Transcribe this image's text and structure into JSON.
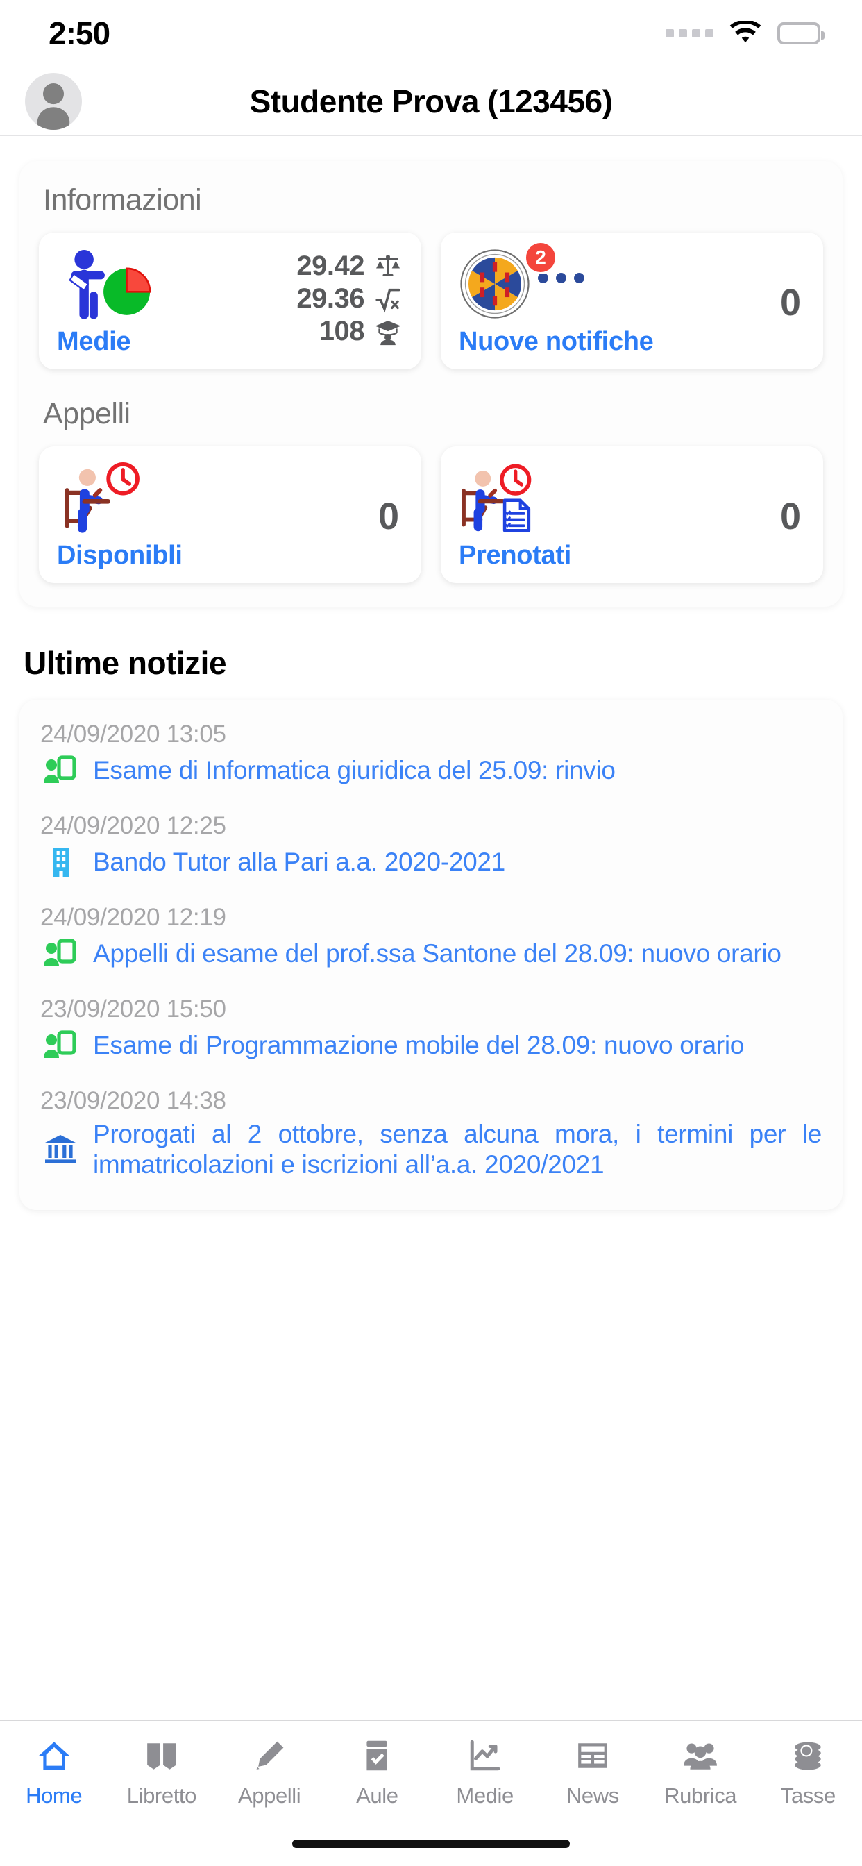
{
  "status_bar": {
    "time": "2:50",
    "signal_icon": "signal-dots-icon",
    "wifi_icon": "wifi-icon",
    "battery_icon": "battery-full-icon"
  },
  "header": {
    "avatar_icon": "avatar-placeholder-icon",
    "title": "Studente Prova (123456)"
  },
  "informazioni": {
    "section_title": "Informazioni",
    "medie_card": {
      "label": "Medie",
      "icon": "student-piechart-icon",
      "stats": [
        {
          "value": "29.42",
          "icon": "balance-scale-icon"
        },
        {
          "value": "29.36",
          "icon": "square-root-icon"
        },
        {
          "value": "108",
          "icon": "graduation-cap-icon"
        }
      ]
    },
    "notifiche_card": {
      "label": "Nuove notifiche",
      "icon": "university-crest-icon",
      "badge": "2",
      "count": "0"
    }
  },
  "appelli": {
    "section_title": "Appelli",
    "cards": [
      {
        "label": "Disponibli",
        "count": "0",
        "icon": "student-desk-clock-icon"
      },
      {
        "label": "Prenotati",
        "count": "0",
        "icon": "student-desk-clock-document-icon"
      }
    ]
  },
  "news": {
    "heading": "Ultime notizie",
    "items": [
      {
        "date": "24/09/2020 13:05",
        "title": "Esame di Informatica giuridica del 25.09: rinvio",
        "icon": "presentation-green-icon"
      },
      {
        "date": "24/09/2020 12:25",
        "title": "Bando Tutor alla Pari a.a. 2020-2021",
        "icon": "building-blue-icon"
      },
      {
        "date": "24/09/2020 12:19",
        "title": "Appelli di esame del prof.ssa Santone del 28.09: nuovo orario",
        "icon": "presentation-green-icon"
      },
      {
        "date": "23/09/2020 15:50",
        "title": "Esame di Programmazione mobile del 28.09: nuovo orario",
        "icon": "presentation-green-icon"
      },
      {
        "date": "23/09/2020 14:38",
        "title": "Prorogati al 2 ottobre, senza alcuna mora, i termini per le immatricolazioni e iscrizioni all’a.a. 2020/2021",
        "icon": "bank-columns-icon"
      }
    ]
  },
  "tabbar": {
    "items": [
      {
        "label": "Home",
        "icon": "home-icon",
        "active": true
      },
      {
        "label": "Libretto",
        "icon": "book-icon",
        "active": false
      },
      {
        "label": "Appelli",
        "icon": "pencil-icon",
        "active": false
      },
      {
        "label": "Aule",
        "icon": "door-check-icon",
        "active": false
      },
      {
        "label": "Medie",
        "icon": "chart-line-icon",
        "active": false
      },
      {
        "label": "News",
        "icon": "newspaper-icon",
        "active": false
      },
      {
        "label": "Rubrica",
        "icon": "people-icon",
        "active": false
      },
      {
        "label": "Tasse",
        "icon": "coins-icon",
        "active": false
      }
    ]
  },
  "colors": {
    "accent_blue": "#2b7cf6",
    "link_blue": "#3b82f6",
    "badge_red": "#f4453c",
    "muted_gray": "#8e8e93"
  }
}
